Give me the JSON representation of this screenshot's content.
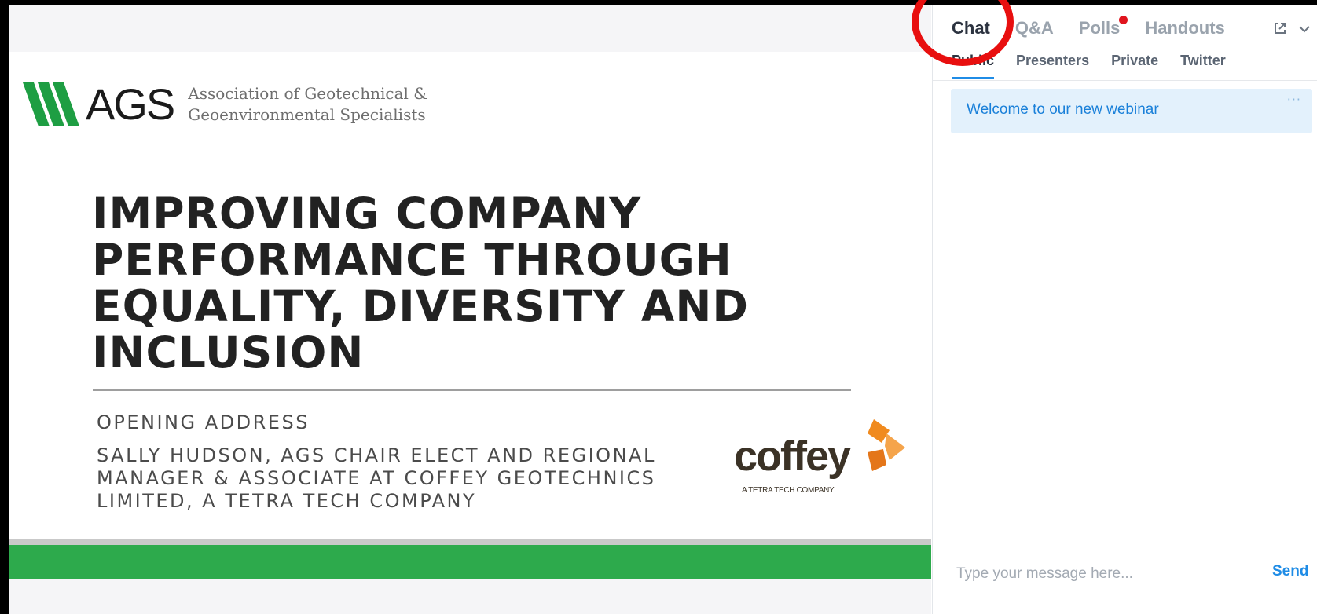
{
  "slide": {
    "logo": {
      "letters": "AGS",
      "org_line1": "Association of Geotechnical &",
      "org_line2": "Geoenvironmental Specialists"
    },
    "title_lines": [
      "IMPROVING COMPANY",
      "PERFORMANCE THROUGH",
      "EQUALITY, DIVERSITY AND",
      "INCLUSION"
    ],
    "subtitle": "OPENING ADDRESS",
    "speaker_lines": [
      "SALLY HUDSON, AGS CHAIR ELECT AND REGIONAL",
      "MANAGER & ASSOCIATE AT COFFEY GEOTECHNICS",
      "LIMITED, A TETRA TECH COMPANY"
    ],
    "sponsor": {
      "name": "coffey",
      "tagline": "A TETRA TECH COMPANY"
    },
    "colors": {
      "ags_green": "#1e9e43",
      "band_green": "#2daa4c",
      "coffey_orange": "#f08a1e"
    }
  },
  "panel": {
    "main_tabs": [
      {
        "label": "Chat",
        "active": true
      },
      {
        "label": "Q&A",
        "active": false
      },
      {
        "label": "Polls",
        "active": false,
        "notification": true
      },
      {
        "label": "Handouts",
        "active": false
      }
    ],
    "icons": [
      "popout-icon",
      "chevron-down-icon"
    ],
    "sub_tabs": [
      {
        "label": "Public",
        "active": true
      },
      {
        "label": "Presenters",
        "active": false
      },
      {
        "label": "Private",
        "active": false
      },
      {
        "label": "Twitter",
        "active": false
      }
    ],
    "messages": [
      {
        "text": "Welcome to our new webinar",
        "more": "···"
      }
    ],
    "composer": {
      "placeholder": "Type your message here...",
      "send_label": "Send"
    },
    "colors": {
      "accent": "#1f8ce6",
      "notification": "#e0141e",
      "annotation": "#e80f0f"
    }
  }
}
